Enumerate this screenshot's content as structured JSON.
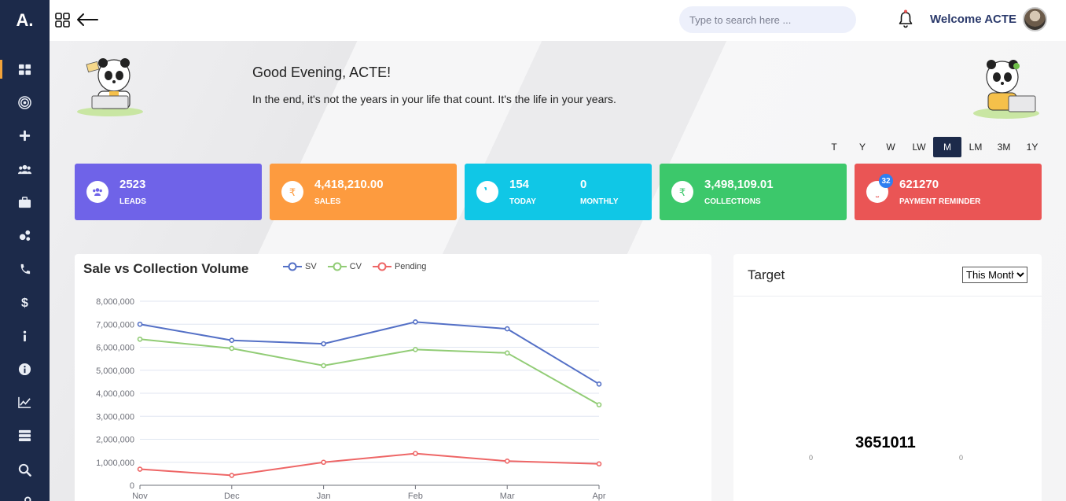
{
  "logo": {
    "text": "A."
  },
  "sidebar": {
    "items": [
      {
        "icon": "dashboard-icon",
        "active": true
      },
      {
        "icon": "target-icon"
      },
      {
        "icon": "plus-icon"
      },
      {
        "icon": "users-icon"
      },
      {
        "icon": "briefcase-icon"
      },
      {
        "icon": "gears-icon"
      },
      {
        "icon": "phone-icon"
      },
      {
        "icon": "dollar-icon"
      },
      {
        "icon": "info-icon"
      },
      {
        "icon": "info-circle-icon"
      },
      {
        "icon": "chart-line-icon"
      },
      {
        "icon": "server-icon"
      },
      {
        "icon": "search-icon"
      },
      {
        "icon": "tools-icon"
      }
    ]
  },
  "topbar": {
    "search_placeholder": "Type to search here ...",
    "welcome": "Welcome ACTE"
  },
  "hero": {
    "title": "Good Evening, ACTE!",
    "subtitle": "In the end, it's not the years in your life that count. It's the life in your years."
  },
  "periods": [
    {
      "label": "T"
    },
    {
      "label": "Y"
    },
    {
      "label": "W"
    },
    {
      "label": "LW"
    },
    {
      "label": "M",
      "active": true
    },
    {
      "label": "LM"
    },
    {
      "label": "3M"
    },
    {
      "label": "1Y"
    }
  ],
  "stats": [
    {
      "value": "2523",
      "label": "LEADS",
      "color": "#6f63e8",
      "icon": "users-icon"
    },
    {
      "value": "4,418,210.00",
      "label": "SALES",
      "color": "#fd9b3f",
      "icon": "rupee-icon"
    },
    {
      "value": "154",
      "label": "TODAY",
      "value2": "0",
      "label2": "MONTHLY",
      "color": "#10c7e6",
      "icon": "phone-icon"
    },
    {
      "value": "3,498,109.01",
      "label": "COLLECTIONS",
      "color": "#3cc86b",
      "icon": "rupee-icon"
    },
    {
      "value": "621270",
      "label": "PAYMENT REMINDER",
      "color": "#ea5555",
      "icon": "bell-icon",
      "badge": "32"
    }
  ],
  "chart_data": {
    "type": "line",
    "title": "Sale vs Collection Volume",
    "categories": [
      "Nov",
      "Dec",
      "Jan",
      "Feb",
      "Mar",
      "Apr"
    ],
    "ylim": [
      0,
      8000000
    ],
    "y_ticks": [
      "0",
      "1,000,000",
      "2,000,000",
      "3,000,000",
      "4,000,000",
      "5,000,000",
      "6,000,000",
      "7,000,000",
      "8,000,000"
    ],
    "grid": true,
    "legend_position": "top",
    "series": [
      {
        "name": "SV",
        "color": "#5470c6",
        "values": [
          7000000,
          6300000,
          6150000,
          7100000,
          6800000,
          4400000
        ]
      },
      {
        "name": "CV",
        "color": "#91cc75",
        "values": [
          6350000,
          5950000,
          5200000,
          5900000,
          5750000,
          3500000
        ]
      },
      {
        "name": "Pending",
        "color": "#ee6666",
        "values": [
          700000,
          430000,
          1000000,
          1380000,
          1050000,
          930000
        ]
      }
    ]
  },
  "target": {
    "title": "Target",
    "select_value": "This Month",
    "value": "3651011",
    "left_zero": "0",
    "right_zero": "0"
  }
}
